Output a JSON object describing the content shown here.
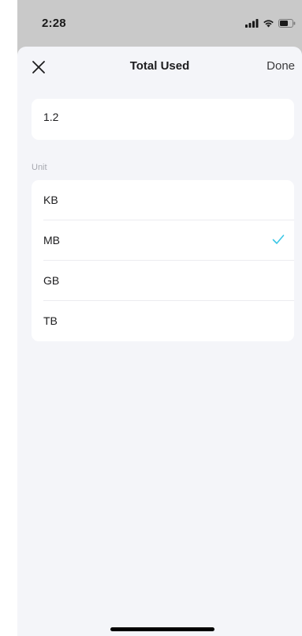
{
  "status_bar": {
    "time": "2:28",
    "icons": [
      "cellular-signal-icon",
      "wifi-icon",
      "battery-icon"
    ]
  },
  "nav": {
    "close_icon": "close-icon",
    "title": "Total Used",
    "done_label": "Done"
  },
  "value_field": {
    "value": "1.2"
  },
  "unit_section": {
    "label": "Unit",
    "options": [
      {
        "label": "KB",
        "selected": false
      },
      {
        "label": "MB",
        "selected": true
      },
      {
        "label": "GB",
        "selected": false
      },
      {
        "label": "TB",
        "selected": false
      }
    ],
    "check_icon": "checkmark-icon",
    "check_color": "#3cc7e6"
  },
  "colors": {
    "status_bar_bg": "#c9c9c9",
    "sheet_bg": "#f4f5f9",
    "card_bg": "#ffffff",
    "accent": "#3cc7e6"
  }
}
